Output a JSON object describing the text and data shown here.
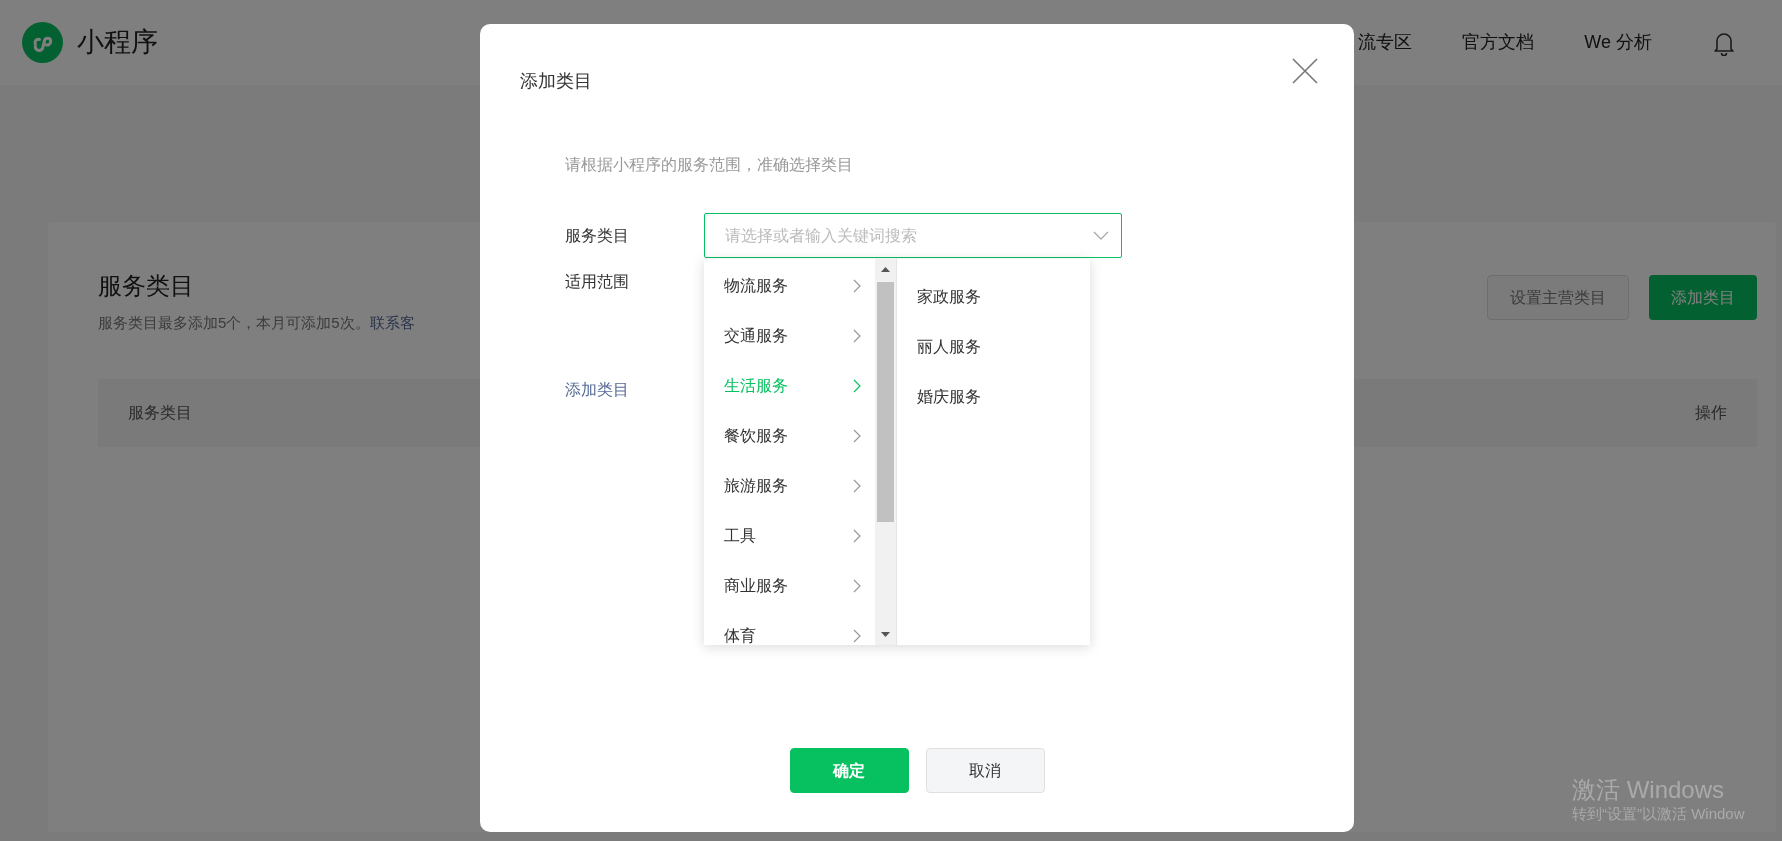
{
  "header": {
    "logo_text": "小程序",
    "nav": [
      "流专区",
      "官方文档",
      "We 分析"
    ]
  },
  "page": {
    "title": "服务类目",
    "description": "服务类目最多添加5个，本月可添加5次。",
    "link": "联系客",
    "buttons": [
      {
        "label": "设置主营类目",
        "kind": "default",
        "disabled": true
      },
      {
        "label": "添加类目",
        "kind": "primary",
        "disabled": false
      }
    ],
    "table": {
      "columns": [
        "服务类目",
        "操作"
      ]
    }
  },
  "dialog": {
    "title": "添加类目",
    "hint": "请根据小程序的服务范围，准确选择类目",
    "fields": [
      {
        "label": "服务类目"
      },
      {
        "label": "适用范围"
      }
    ],
    "select": {
      "placeholder": "请选择或者输入关键词搜索"
    },
    "categories": [
      {
        "label": "物流服务",
        "selected": false
      },
      {
        "label": "交通服务",
        "selected": false
      },
      {
        "label": "生活服务",
        "selected": true
      },
      {
        "label": "餐饮服务",
        "selected": false
      },
      {
        "label": "旅游服务",
        "selected": false
      },
      {
        "label": "工具",
        "selected": false
      },
      {
        "label": "商业服务",
        "selected": false
      },
      {
        "label": "体育",
        "selected": false
      }
    ],
    "subcategories": [
      "家政服务",
      "丽人服务",
      "婚庆服务"
    ],
    "add_link": "添加类目",
    "buttons": [
      {
        "label": "确定",
        "kind": "primary"
      },
      {
        "label": "取消",
        "kind": "default"
      }
    ]
  },
  "system_notice": {
    "title": "激活 Windows",
    "subtitle": "转到“设置”以激活 Window"
  }
}
